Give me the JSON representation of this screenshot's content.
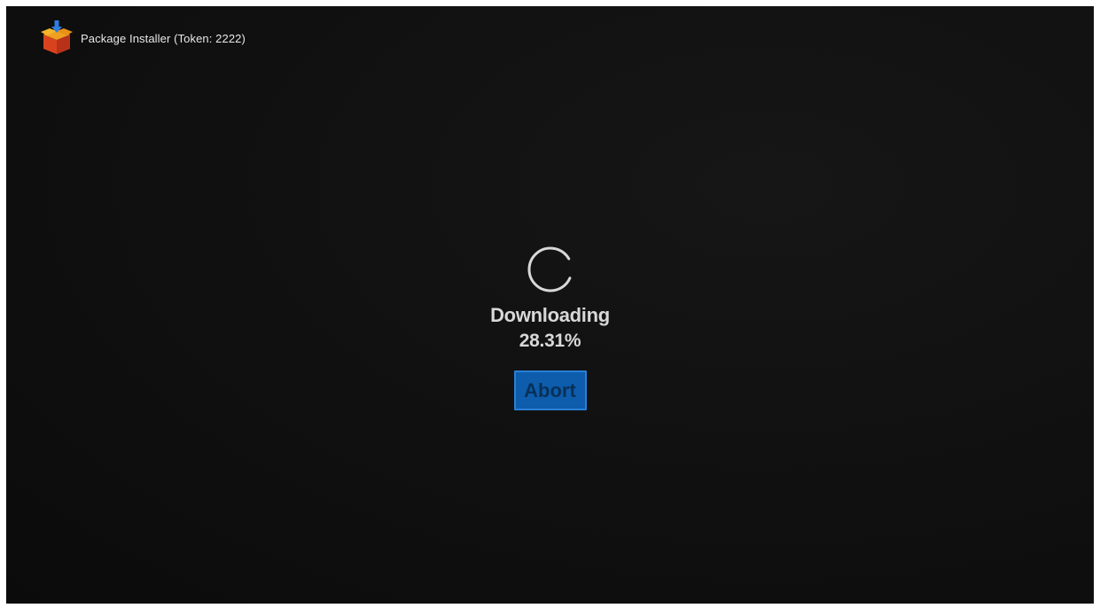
{
  "window": {
    "title": "Package Installer (Token: 2222)",
    "icon": "package-box-icon"
  },
  "download": {
    "spinner_icon": "loading-spinner-icon",
    "status": "Downloading",
    "progress_text": "28.31%",
    "progress_fraction": 0.2831
  },
  "actions": {
    "abort_label": "Abort"
  },
  "colors": {
    "background": "#111111",
    "text": "#d8d8d8",
    "button_fill": "#0d5dac",
    "button_text": "#08305a"
  }
}
